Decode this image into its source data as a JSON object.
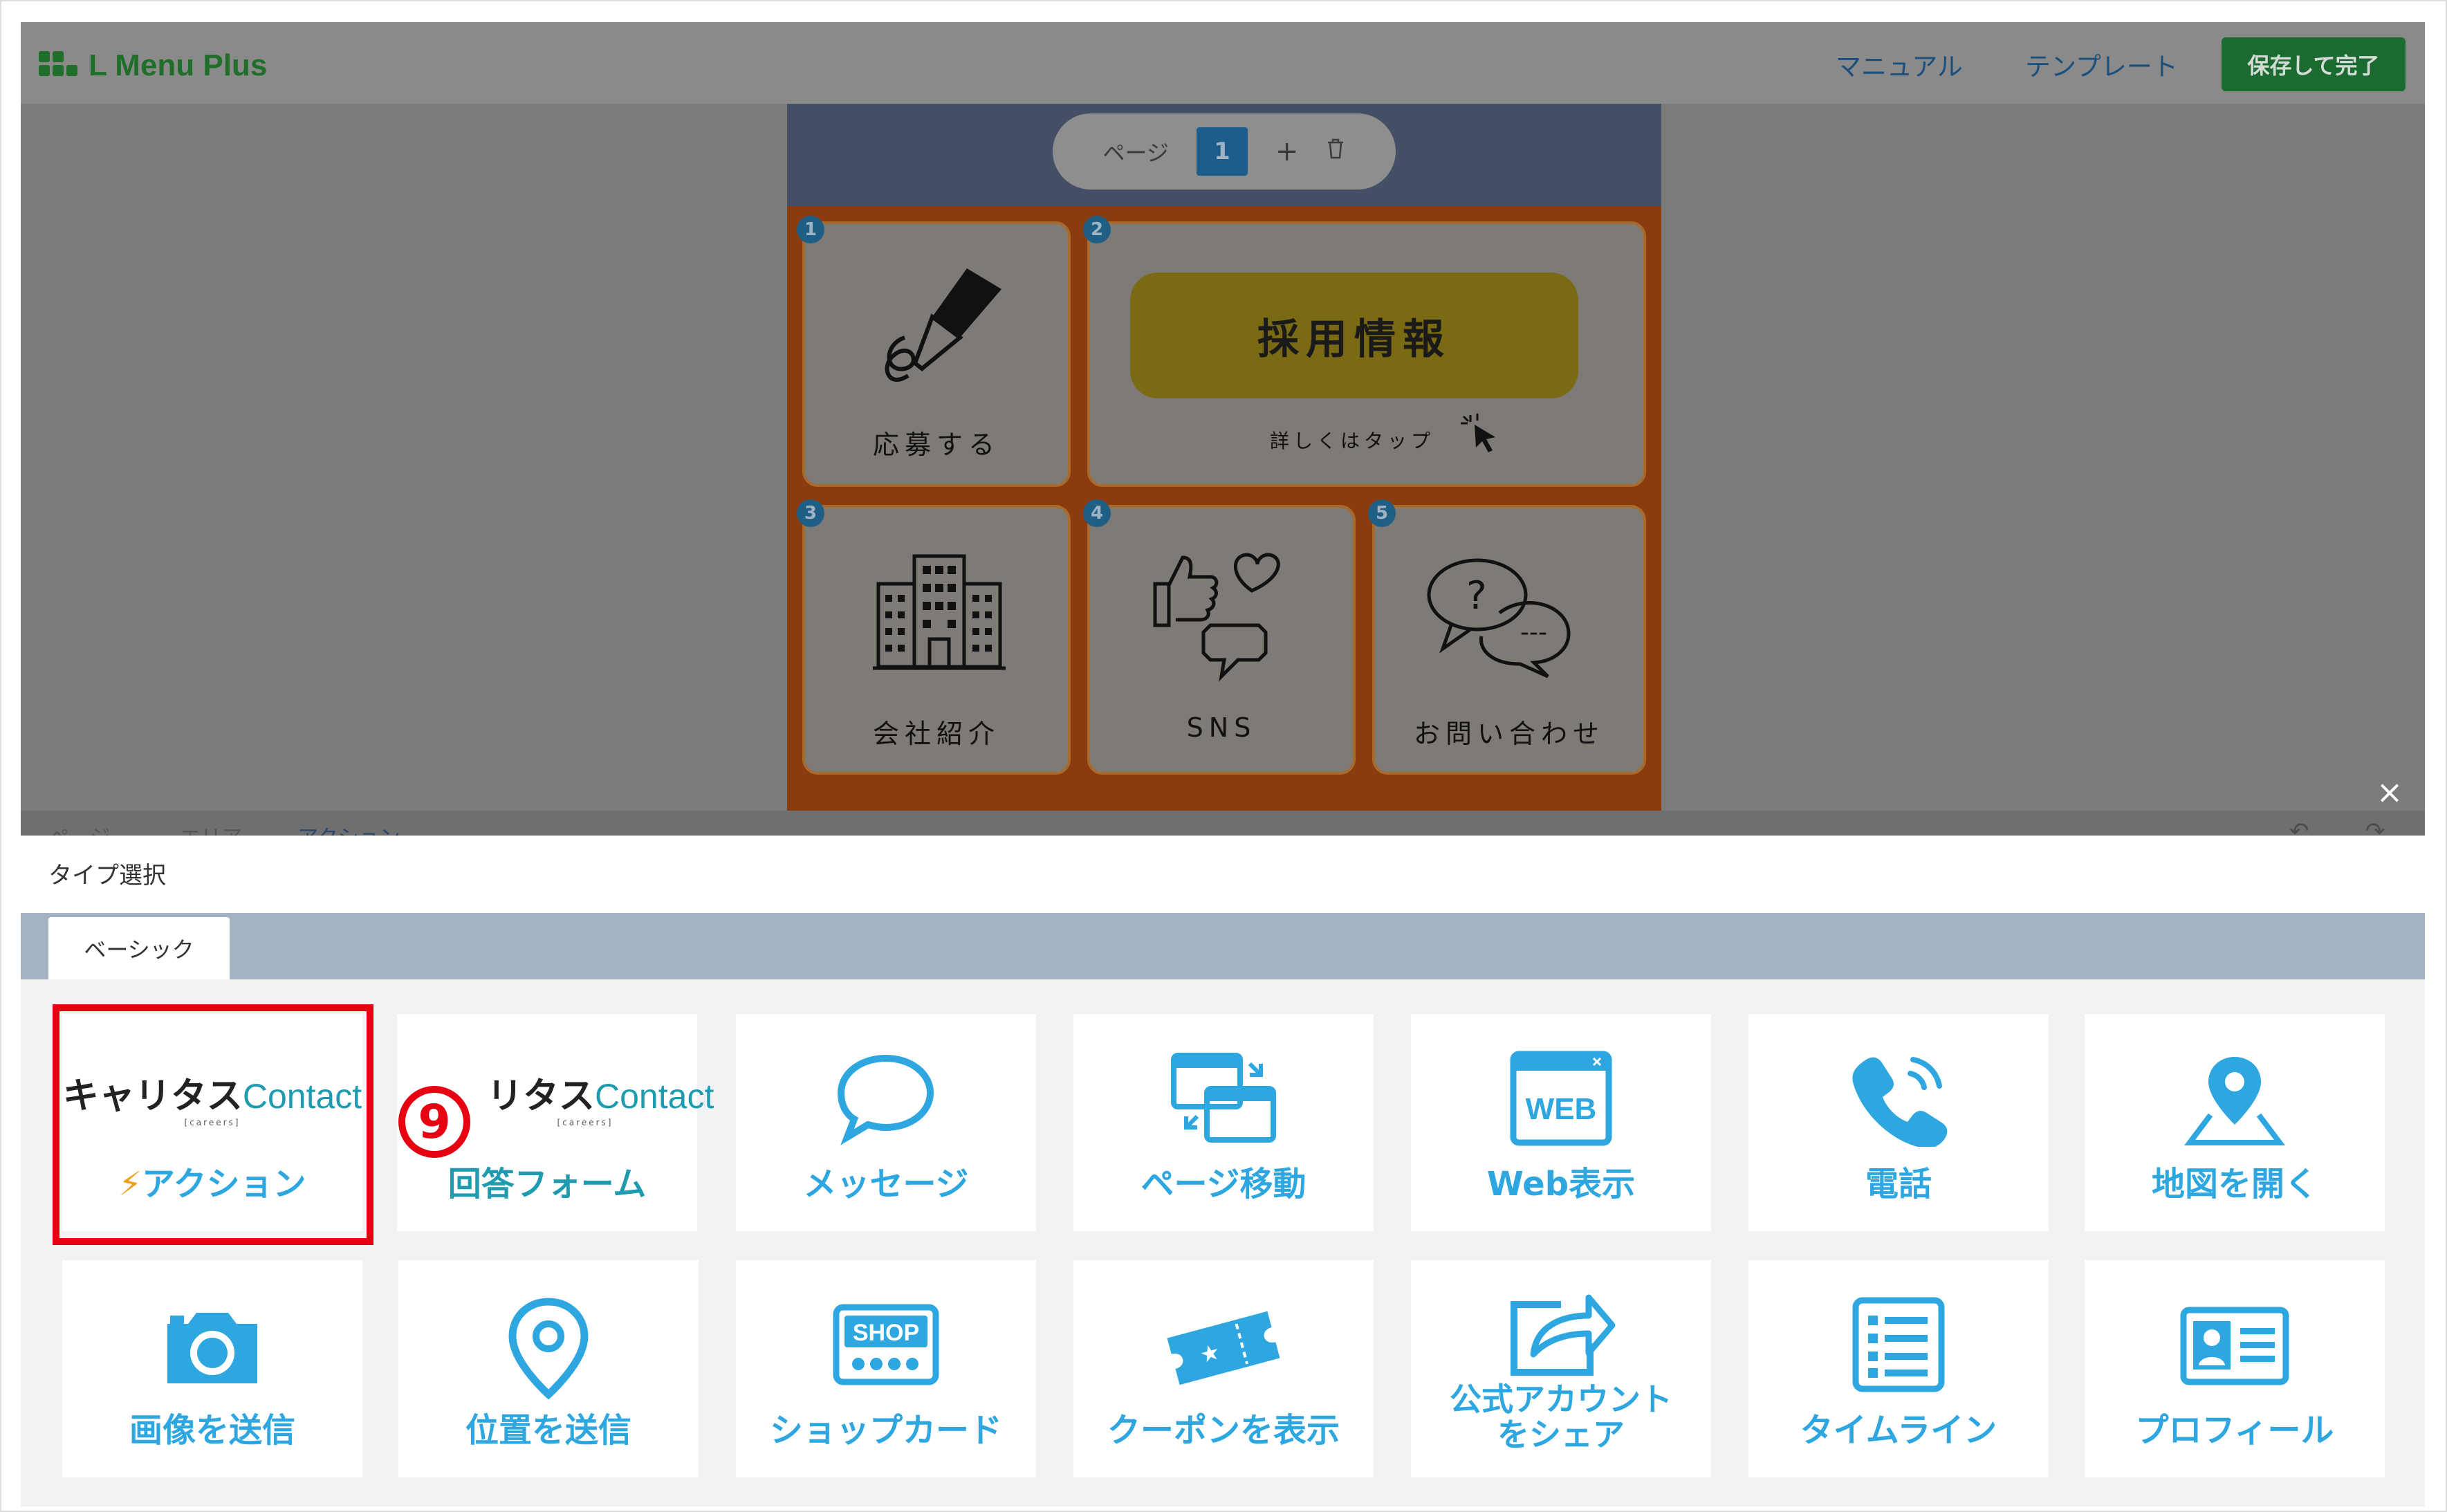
{
  "app": {
    "title": "L Menu Plus",
    "nav": {
      "manual": "マニュアル",
      "template": "テンプレート",
      "save": "保存して完了"
    },
    "pager": {
      "label": "ページ",
      "current": "1",
      "add_icon": "+",
      "delete_icon": "🗑"
    },
    "menu_cells": [
      {
        "no": "1",
        "label": "応募する",
        "icon": "pen-icon"
      },
      {
        "no": "2",
        "label": "採用情報",
        "sub": "詳しくはタップ",
        "icon": "cursor-click-icon"
      },
      {
        "no": "3",
        "label": "会社紹介",
        "icon": "building-icon"
      },
      {
        "no": "4",
        "label": "SNS",
        "icon": "like-heart-chat-icon"
      },
      {
        "no": "5",
        "label": "お問い合わせ",
        "icon": "question-chat-icon"
      }
    ],
    "bottom_tabs": [
      "ページ",
      "エリア",
      "アクション"
    ],
    "colors": {
      "brand_green": "#1f6e2a",
      "accent_blue": "#2ea7e0",
      "highlight_red": "#e60012"
    }
  },
  "modal": {
    "close_icon": "×",
    "title": "タイプ選択",
    "tab": "ベーシック",
    "step_marker": "9",
    "tiles": [
      {
        "brand_jp": "キャリタス",
        "brand_en": "Contact",
        "brand_sub": "[careers]",
        "label": "アクション",
        "bolt": "⚡",
        "icon": "careers-contact-logo"
      },
      {
        "brand_jp": "リタス",
        "brand_en": "Contact",
        "brand_sub": "[careers]",
        "label": "回答フォーム",
        "icon": "careers-contact-logo"
      },
      {
        "label": "メッセージ",
        "icon": "speech-bubble-icon"
      },
      {
        "label": "ページ移動",
        "icon": "page-switch-icon"
      },
      {
        "label": "Web表示",
        "icon": "web-window-icon",
        "icon_text": "WEB"
      },
      {
        "label": "電話",
        "icon": "phone-icon"
      },
      {
        "label": "地図を開く",
        "icon": "map-pin-icon"
      },
      {
        "label": "画像を送信",
        "icon": "camera-icon"
      },
      {
        "label": "位置を送信",
        "icon": "location-icon"
      },
      {
        "label": "ショップカード",
        "icon": "shop-card-icon",
        "icon_text": "SHOP"
      },
      {
        "label": "クーポンを表示",
        "icon": "coupon-icon"
      },
      {
        "label": "公式アカウントをシェア",
        "label_line1": "公式アカウント",
        "label_line2": "をシェア",
        "icon": "share-icon"
      },
      {
        "label": "タイムライン",
        "icon": "timeline-icon"
      },
      {
        "label": "プロフィール",
        "icon": "profile-card-icon"
      }
    ]
  }
}
